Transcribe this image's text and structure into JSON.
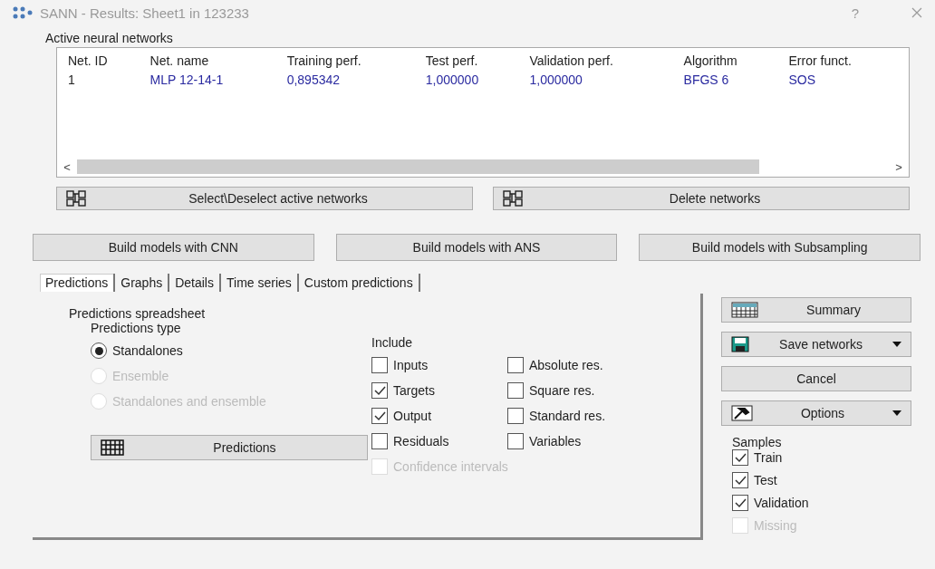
{
  "window": {
    "title": "SANN - Results: Sheet1 in 123233",
    "help": "?"
  },
  "networks": {
    "label": "Active neural networks",
    "columns": [
      "Net. ID",
      "Net. name",
      "Training perf.",
      "Test perf.",
      "Validation perf.",
      "Algorithm",
      "Error funct."
    ],
    "rows": [
      {
        "cells": [
          "1",
          "MLP 12-14-1",
          "0,895342",
          "1,000000",
          "1,000000",
          "BFGS 6",
          "SOS"
        ]
      }
    ],
    "scroll_left": "<",
    "scroll_right": ">"
  },
  "network_buttons": [
    "Select\\Deselect active networks",
    "Delete networks"
  ],
  "build_buttons": [
    "Build models with CNN",
    "Build  models with ANS",
    "Build models with Subsampling"
  ],
  "tabs": [
    {
      "label": "Predictions",
      "selected": true
    },
    {
      "label": "Graphs",
      "selected": false
    },
    {
      "label": "Details",
      "selected": false
    },
    {
      "label": "Time series",
      "selected": false
    },
    {
      "label": "Custom predictions",
      "selected": false
    }
  ],
  "predictions": {
    "title": "Predictions spreadsheet",
    "type_group": {
      "label": "Predictions type",
      "options": [
        {
          "label": "Standalones",
          "selected": true,
          "disabled": false
        },
        {
          "label": "Ensemble",
          "selected": false,
          "disabled": true
        },
        {
          "label": "Standalones and ensemble",
          "selected": false,
          "disabled": true
        }
      ]
    },
    "include": {
      "label": "Include",
      "options": [
        {
          "label": "Inputs",
          "checked": false,
          "disabled": false
        },
        {
          "label": "Absolute res.",
          "checked": false,
          "disabled": false
        },
        {
          "label": "Targets",
          "checked": true,
          "disabled": false
        },
        {
          "label": "Square res.",
          "checked": false,
          "disabled": false
        },
        {
          "label": "Output",
          "checked": true,
          "disabled": false
        },
        {
          "label": "Standard res.",
          "checked": false,
          "disabled": false
        },
        {
          "label": "Residuals",
          "checked": false,
          "disabled": false
        },
        {
          "label": "Variables",
          "checked": false,
          "disabled": false
        },
        {
          "label": "Confidence intervals",
          "checked": false,
          "disabled": true
        }
      ]
    },
    "button": "Predictions"
  },
  "side_buttons": [
    {
      "label": "Summary",
      "kind": "summary",
      "dropdown": false
    },
    {
      "label": "Save networks",
      "kind": "save",
      "dropdown": true
    },
    {
      "label": "Cancel",
      "kind": "plain",
      "dropdown": false
    },
    {
      "label": "Options",
      "kind": "options",
      "dropdown": true
    }
  ],
  "samples": {
    "label": "Samples",
    "options": [
      {
        "label": "Train",
        "checked": true,
        "disabled": false
      },
      {
        "label": "Test",
        "checked": true,
        "disabled": false
      },
      {
        "label": "Validation",
        "checked": true,
        "disabled": false
      },
      {
        "label": "Missing",
        "checked": false,
        "disabled": true
      }
    ]
  }
}
